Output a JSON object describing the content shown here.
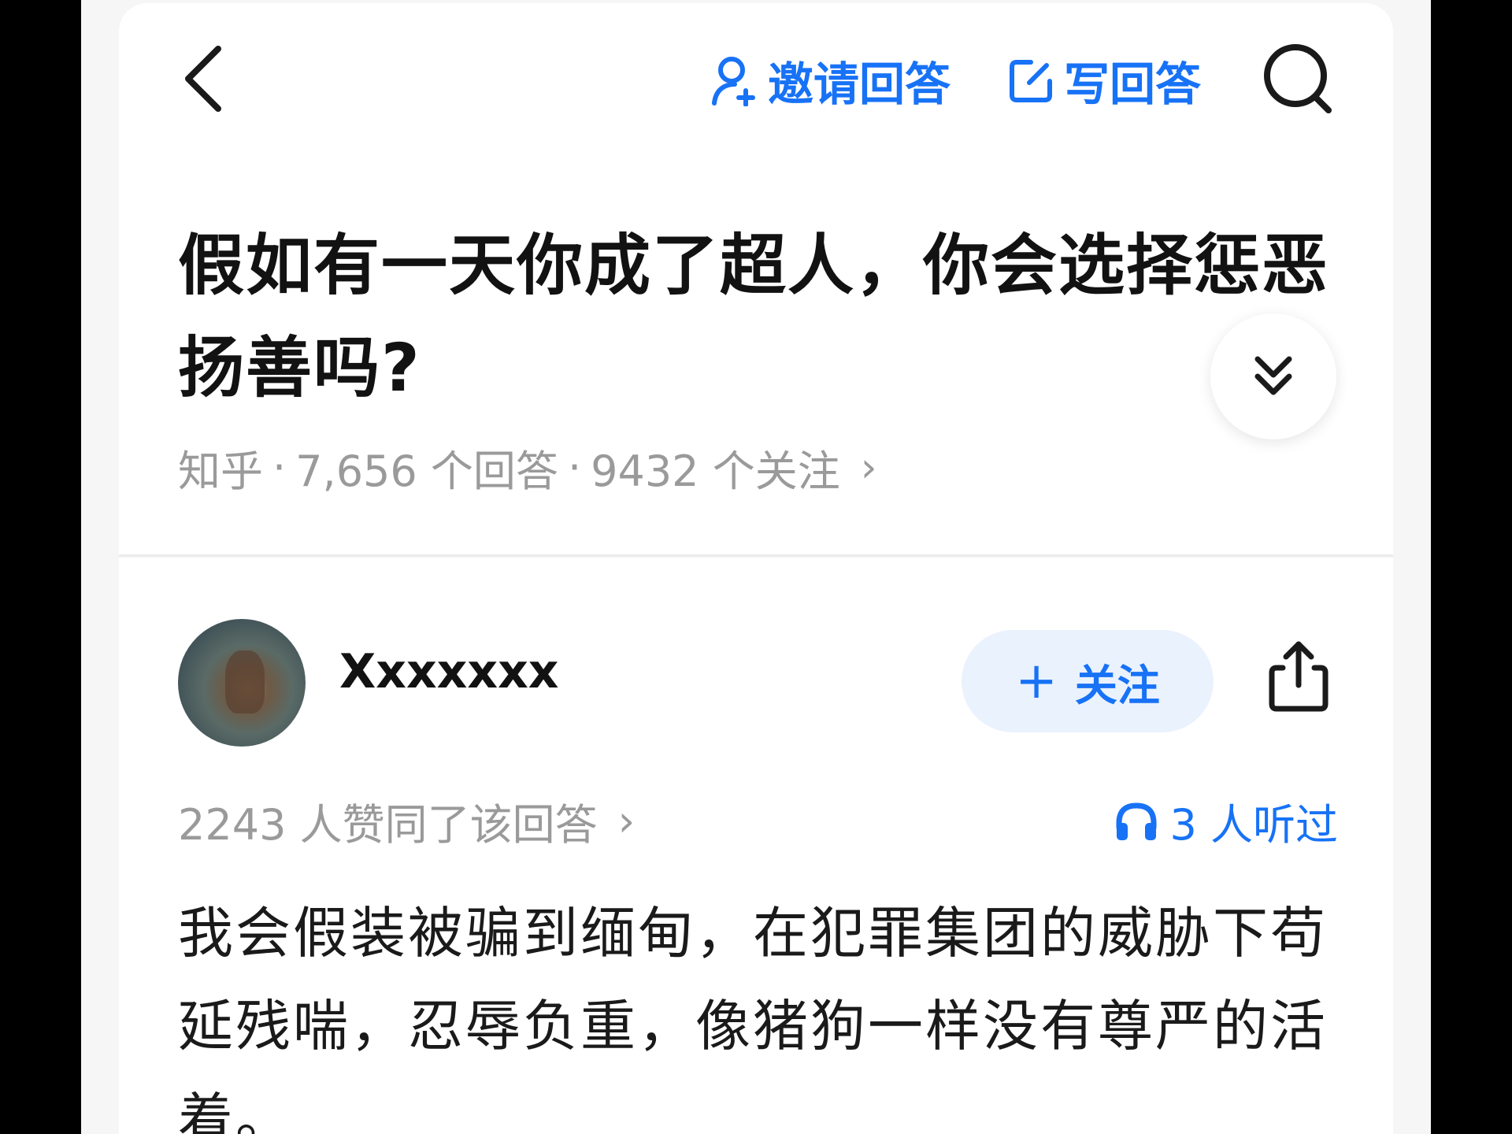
{
  "topbar": {
    "invite_label": "邀请回答",
    "write_label": "写回答"
  },
  "question": {
    "title": "假如有一天你成了超人，你会选择惩恶扬善吗?",
    "source": "知乎",
    "answers_count": "7,656 个回答",
    "followers_count": "9432 个关注",
    "separator": "·",
    "chevron": "›"
  },
  "answer": {
    "author_name": "Xxxxxxx",
    "follow_plus": "+",
    "follow_label": "关注",
    "votes_text": "2243 人赞同了该回答",
    "votes_chevron": "›",
    "listened_text": "3 人听过",
    "content": "我会假装被骗到缅甸，在犯罪集团的威胁下苟延残喘，忍辱负重，像猪狗一样没有尊严的活着。"
  },
  "colors": {
    "accent": "#1772f6",
    "muted_text": "#9a9a9a",
    "title_text": "#121212",
    "follow_bg": "#eaf2fe"
  },
  "icons": [
    "back-chevron-icon",
    "invite-person-icon",
    "edit-icon",
    "search-icon",
    "double-chevron-down-icon",
    "share-icon",
    "headphones-icon"
  ]
}
